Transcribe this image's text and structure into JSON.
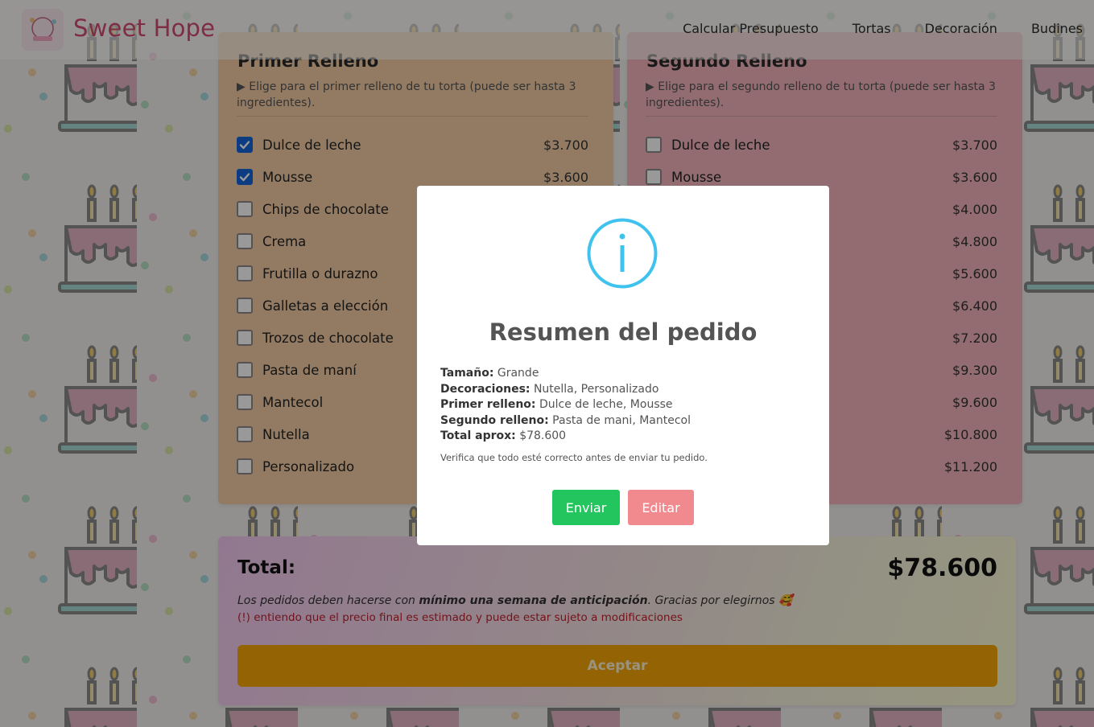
{
  "brand": {
    "name": "Sweet Hope",
    "logo_icon": "cake-logo-icon"
  },
  "nav": {
    "items": [
      {
        "label": "Calcular Presupuesto"
      },
      {
        "label": "Tortas"
      },
      {
        "label": "Decoración"
      },
      {
        "label": "Budines"
      }
    ]
  },
  "first_filling": {
    "title": "Primer Relleno",
    "description": "▶ Elige para el primer relleno de tu torta (puede ser hasta 3 ingredientes).",
    "options": [
      {
        "label": "Dulce de leche",
        "price": "$3.700",
        "checked": true
      },
      {
        "label": "Mousse",
        "price": "$3.600",
        "checked": true
      },
      {
        "label": "Chips de chocolate",
        "price": "$4.000",
        "checked": false
      },
      {
        "label": "Crema",
        "price": "$4.800",
        "checked": false
      },
      {
        "label": "Frutilla o durazno",
        "price": "$5.600",
        "checked": false
      },
      {
        "label": "Galletas a elección",
        "price": "$6.400",
        "checked": false
      },
      {
        "label": "Trozos de chocolate",
        "price": "$7.200",
        "checked": false
      },
      {
        "label": "Pasta de maní",
        "price": "$9.300",
        "checked": false
      },
      {
        "label": "Mantecol",
        "price": "$9.600",
        "checked": false
      },
      {
        "label": "Nutella",
        "price": "$10.800",
        "checked": false
      },
      {
        "label": "Personalizado",
        "price": "$11.200",
        "checked": false
      }
    ]
  },
  "second_filling": {
    "title": "Segundo Relleno",
    "description": "▶ Elige para el segundo relleno de tu torta (puede ser hasta 3 ingredientes).",
    "options": [
      {
        "label": "Dulce de leche",
        "price": "$3.700",
        "checked": false
      },
      {
        "label": "Mousse",
        "price": "$3.600",
        "checked": false
      },
      {
        "label": "",
        "price": "$4.000",
        "checked": false
      },
      {
        "label": "",
        "price": "$4.800",
        "checked": false
      },
      {
        "label": "",
        "price": "$5.600",
        "checked": false
      },
      {
        "label": "",
        "price": "$6.400",
        "checked": false
      },
      {
        "label": "",
        "price": "$7.200",
        "checked": false
      },
      {
        "label": "",
        "price": "$9.300",
        "checked": false
      },
      {
        "label": "",
        "price": "$9.600",
        "checked": false
      },
      {
        "label": "",
        "price": "$10.800",
        "checked": false
      },
      {
        "label": "",
        "price": "$11.200",
        "checked": false
      }
    ]
  },
  "total": {
    "label": "Total:",
    "value": "$78.600",
    "note_prefix": "Los pedidos deben hacerse con ",
    "note_bold": "mínimo una semana de anticipación",
    "note_suffix": ". Gracias por elegirnos 🥰",
    "warning": "(!) entiendo que el precio final es estimado y puede estar sujeto a modificaciones",
    "accept_label": "Aceptar"
  },
  "modal": {
    "icon": "info-icon",
    "title": "Resumen del pedido",
    "rows": [
      {
        "key": "Tamaño:",
        "value": " Grande"
      },
      {
        "key": "Decoraciones:",
        "value": " Nutella, Personalizado"
      },
      {
        "key": "Primer relleno:",
        "value": " Dulce de leche, Mousse"
      },
      {
        "key": "Segundo relleno:",
        "value": " Pasta de mani, Mantecol"
      },
      {
        "key": "Total aprox:",
        "value": " $78.600"
      }
    ],
    "verify_text": "Verifica que todo esté correcto antes de enviar tu pedido.",
    "send_label": "Enviar",
    "edit_label": "Editar"
  },
  "colors": {
    "brand": "#d44a73",
    "first_card": "#f6cea5",
    "second_card": "#f3b5bd",
    "accept": "#f7a507",
    "send": "#22c55e",
    "edit": "#f08a8e",
    "info": "#3fc3ee"
  }
}
